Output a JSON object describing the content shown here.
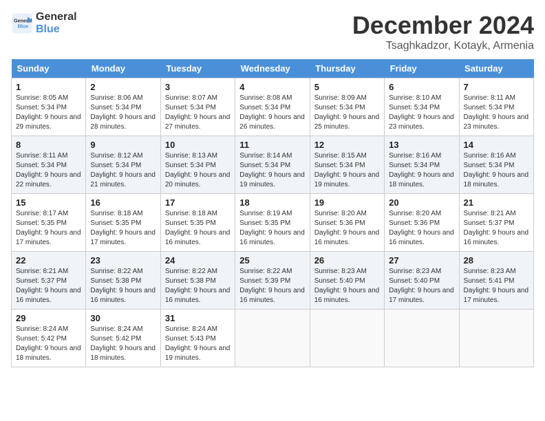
{
  "header": {
    "logo_line1": "General",
    "logo_line2": "Blue",
    "month": "December 2024",
    "location": "Tsaghkadzor, Kotayk, Armenia"
  },
  "days_of_week": [
    "Sunday",
    "Monday",
    "Tuesday",
    "Wednesday",
    "Thursday",
    "Friday",
    "Saturday"
  ],
  "weeks": [
    [
      {
        "day": "1",
        "sunrise": "8:05 AM",
        "sunset": "5:34 PM",
        "daylight": "9 hours and 29 minutes."
      },
      {
        "day": "2",
        "sunrise": "8:06 AM",
        "sunset": "5:34 PM",
        "daylight": "9 hours and 28 minutes."
      },
      {
        "day": "3",
        "sunrise": "8:07 AM",
        "sunset": "5:34 PM",
        "daylight": "9 hours and 27 minutes."
      },
      {
        "day": "4",
        "sunrise": "8:08 AM",
        "sunset": "5:34 PM",
        "daylight": "9 hours and 26 minutes."
      },
      {
        "day": "5",
        "sunrise": "8:09 AM",
        "sunset": "5:34 PM",
        "daylight": "9 hours and 25 minutes."
      },
      {
        "day": "6",
        "sunrise": "8:10 AM",
        "sunset": "5:34 PM",
        "daylight": "9 hours and 23 minutes."
      },
      {
        "day": "7",
        "sunrise": "8:11 AM",
        "sunset": "5:34 PM",
        "daylight": "9 hours and 23 minutes."
      }
    ],
    [
      {
        "day": "8",
        "sunrise": "8:11 AM",
        "sunset": "5:34 PM",
        "daylight": "9 hours and 22 minutes."
      },
      {
        "day": "9",
        "sunrise": "8:12 AM",
        "sunset": "5:34 PM",
        "daylight": "9 hours and 21 minutes."
      },
      {
        "day": "10",
        "sunrise": "8:13 AM",
        "sunset": "5:34 PM",
        "daylight": "9 hours and 20 minutes."
      },
      {
        "day": "11",
        "sunrise": "8:14 AM",
        "sunset": "5:34 PM",
        "daylight": "9 hours and 19 minutes."
      },
      {
        "day": "12",
        "sunrise": "8:15 AM",
        "sunset": "5:34 PM",
        "daylight": "9 hours and 19 minutes."
      },
      {
        "day": "13",
        "sunrise": "8:16 AM",
        "sunset": "5:34 PM",
        "daylight": "9 hours and 18 minutes."
      },
      {
        "day": "14",
        "sunrise": "8:16 AM",
        "sunset": "5:34 PM",
        "daylight": "9 hours and 18 minutes."
      }
    ],
    [
      {
        "day": "15",
        "sunrise": "8:17 AM",
        "sunset": "5:35 PM",
        "daylight": "9 hours and 17 minutes."
      },
      {
        "day": "16",
        "sunrise": "8:18 AM",
        "sunset": "5:35 PM",
        "daylight": "9 hours and 17 minutes."
      },
      {
        "day": "17",
        "sunrise": "8:18 AM",
        "sunset": "5:35 PM",
        "daylight": "9 hours and 16 minutes."
      },
      {
        "day": "18",
        "sunrise": "8:19 AM",
        "sunset": "5:35 PM",
        "daylight": "9 hours and 16 minutes."
      },
      {
        "day": "19",
        "sunrise": "8:20 AM",
        "sunset": "5:36 PM",
        "daylight": "9 hours and 16 minutes."
      },
      {
        "day": "20",
        "sunrise": "8:20 AM",
        "sunset": "5:36 PM",
        "daylight": "9 hours and 16 minutes."
      },
      {
        "day": "21",
        "sunrise": "8:21 AM",
        "sunset": "5:37 PM",
        "daylight": "9 hours and 16 minutes."
      }
    ],
    [
      {
        "day": "22",
        "sunrise": "8:21 AM",
        "sunset": "5:37 PM",
        "daylight": "9 hours and 16 minutes."
      },
      {
        "day": "23",
        "sunrise": "8:22 AM",
        "sunset": "5:38 PM",
        "daylight": "9 hours and 16 minutes."
      },
      {
        "day": "24",
        "sunrise": "8:22 AM",
        "sunset": "5:38 PM",
        "daylight": "9 hours and 16 minutes."
      },
      {
        "day": "25",
        "sunrise": "8:22 AM",
        "sunset": "5:39 PM",
        "daylight": "9 hours and 16 minutes."
      },
      {
        "day": "26",
        "sunrise": "8:23 AM",
        "sunset": "5:40 PM",
        "daylight": "9 hours and 16 minutes."
      },
      {
        "day": "27",
        "sunrise": "8:23 AM",
        "sunset": "5:40 PM",
        "daylight": "9 hours and 17 minutes."
      },
      {
        "day": "28",
        "sunrise": "8:23 AM",
        "sunset": "5:41 PM",
        "daylight": "9 hours and 17 minutes."
      }
    ],
    [
      {
        "day": "29",
        "sunrise": "8:24 AM",
        "sunset": "5:42 PM",
        "daylight": "9 hours and 18 minutes."
      },
      {
        "day": "30",
        "sunrise": "8:24 AM",
        "sunset": "5:42 PM",
        "daylight": "9 hours and 18 minutes."
      },
      {
        "day": "31",
        "sunrise": "8:24 AM",
        "sunset": "5:43 PM",
        "daylight": "9 hours and 19 minutes."
      },
      null,
      null,
      null,
      null
    ]
  ],
  "labels": {
    "sunrise": "Sunrise: ",
    "sunset": "Sunset: ",
    "daylight": "Daylight: "
  }
}
